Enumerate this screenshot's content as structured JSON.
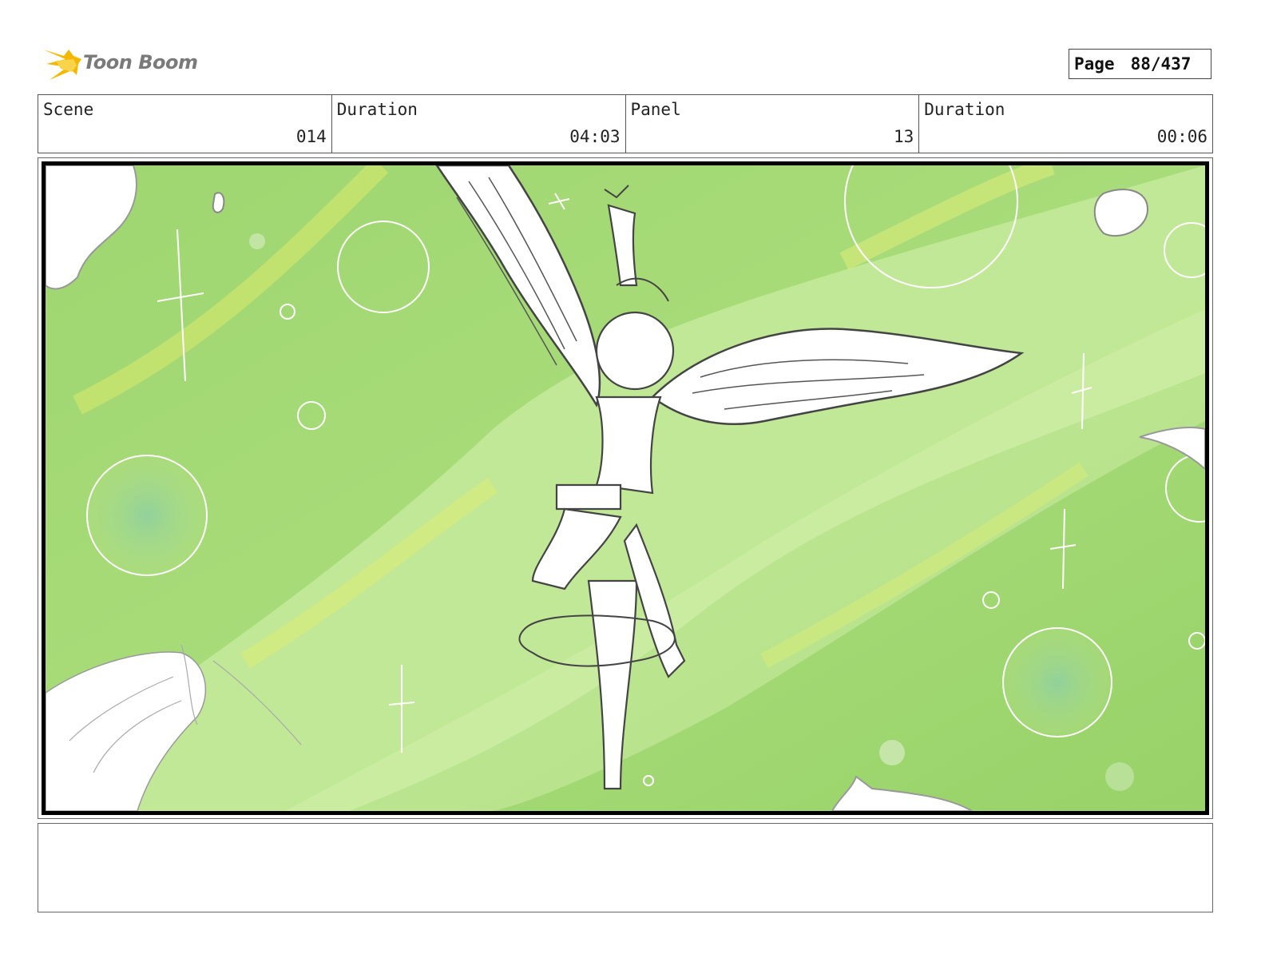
{
  "header": {
    "brand": "Toon Boom",
    "page_label": "Page",
    "page_value": "88/437"
  },
  "info": {
    "scene_label": "Scene",
    "scene_value": "014",
    "scene_duration_label": "Duration",
    "scene_duration_value": "04:03",
    "panel_label": "Panel",
    "panel_value": "13",
    "panel_duration_label": "Duration",
    "panel_duration_value": "00:06"
  },
  "colors": {
    "sky_light": "#d4f0b0",
    "sky_mid": "#a9dc78",
    "sky_dark": "#8fce6a",
    "brand_orange": "#f5b800",
    "sketch_line": "#444444"
  },
  "notes": {
    "text": ""
  }
}
